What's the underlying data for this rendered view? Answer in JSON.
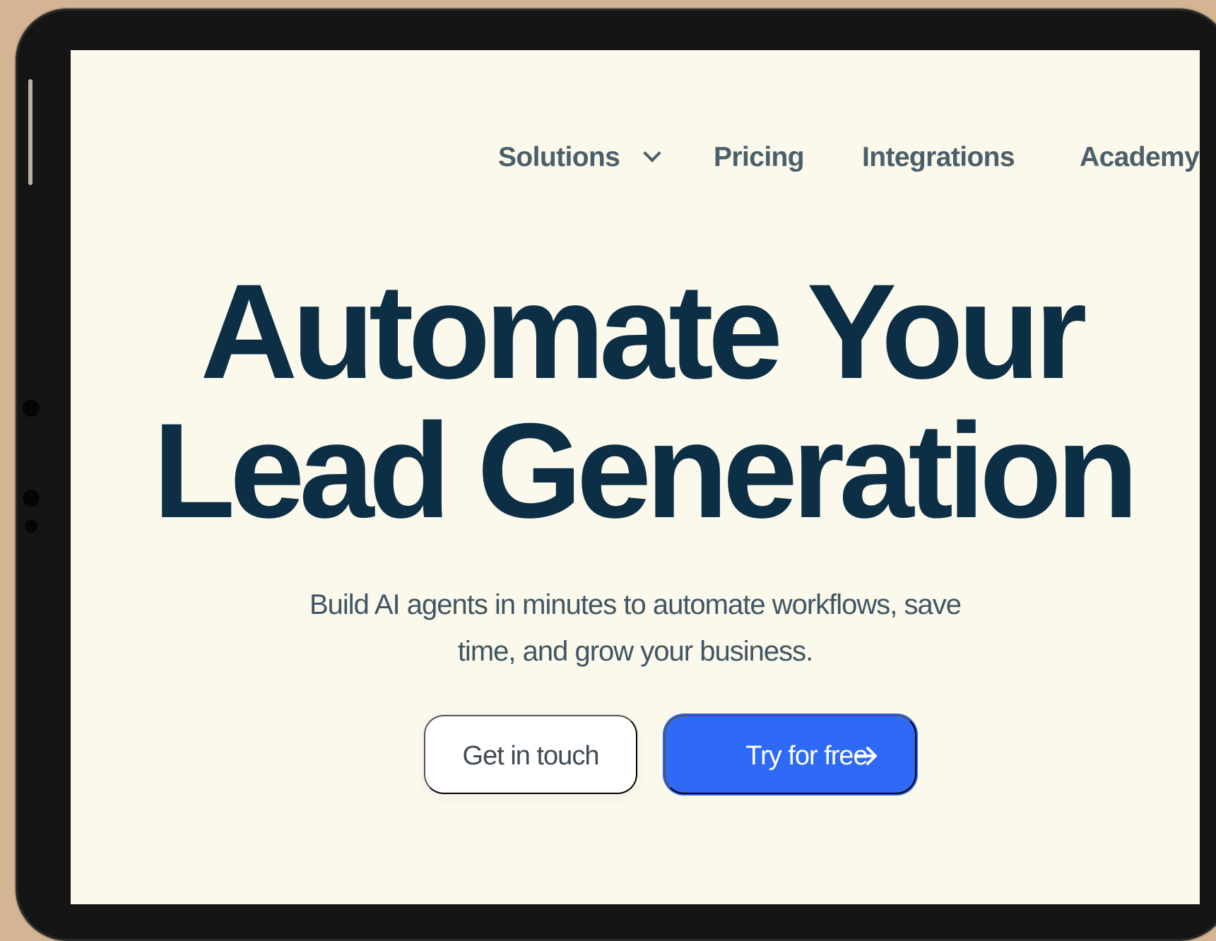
{
  "navigation": {
    "items": [
      {
        "label": "Solutions",
        "icon": "chevron-down-icon"
      },
      {
        "label": "Pricing"
      },
      {
        "label": "Integrations"
      },
      {
        "label": "Academy"
      }
    ]
  },
  "hero": {
    "title_line_1": "Automate Your",
    "title_line_2": "Lead Generation",
    "subtitle_line_1": "Build AI agents in minutes to automate workflows, save",
    "subtitle_line_2": "time, and grow your business."
  },
  "actions": {
    "secondary_label": "Get in touch",
    "primary_label": "Try for free",
    "primary_icon": "arrow-right-icon"
  },
  "colors": {
    "page_background": "#d3b493",
    "device_frame": "#151515",
    "screen_background": "#fbf8ec",
    "heading": "#0d2f45",
    "body_text": "#3f5662",
    "primary_button": "#2e6af5"
  }
}
